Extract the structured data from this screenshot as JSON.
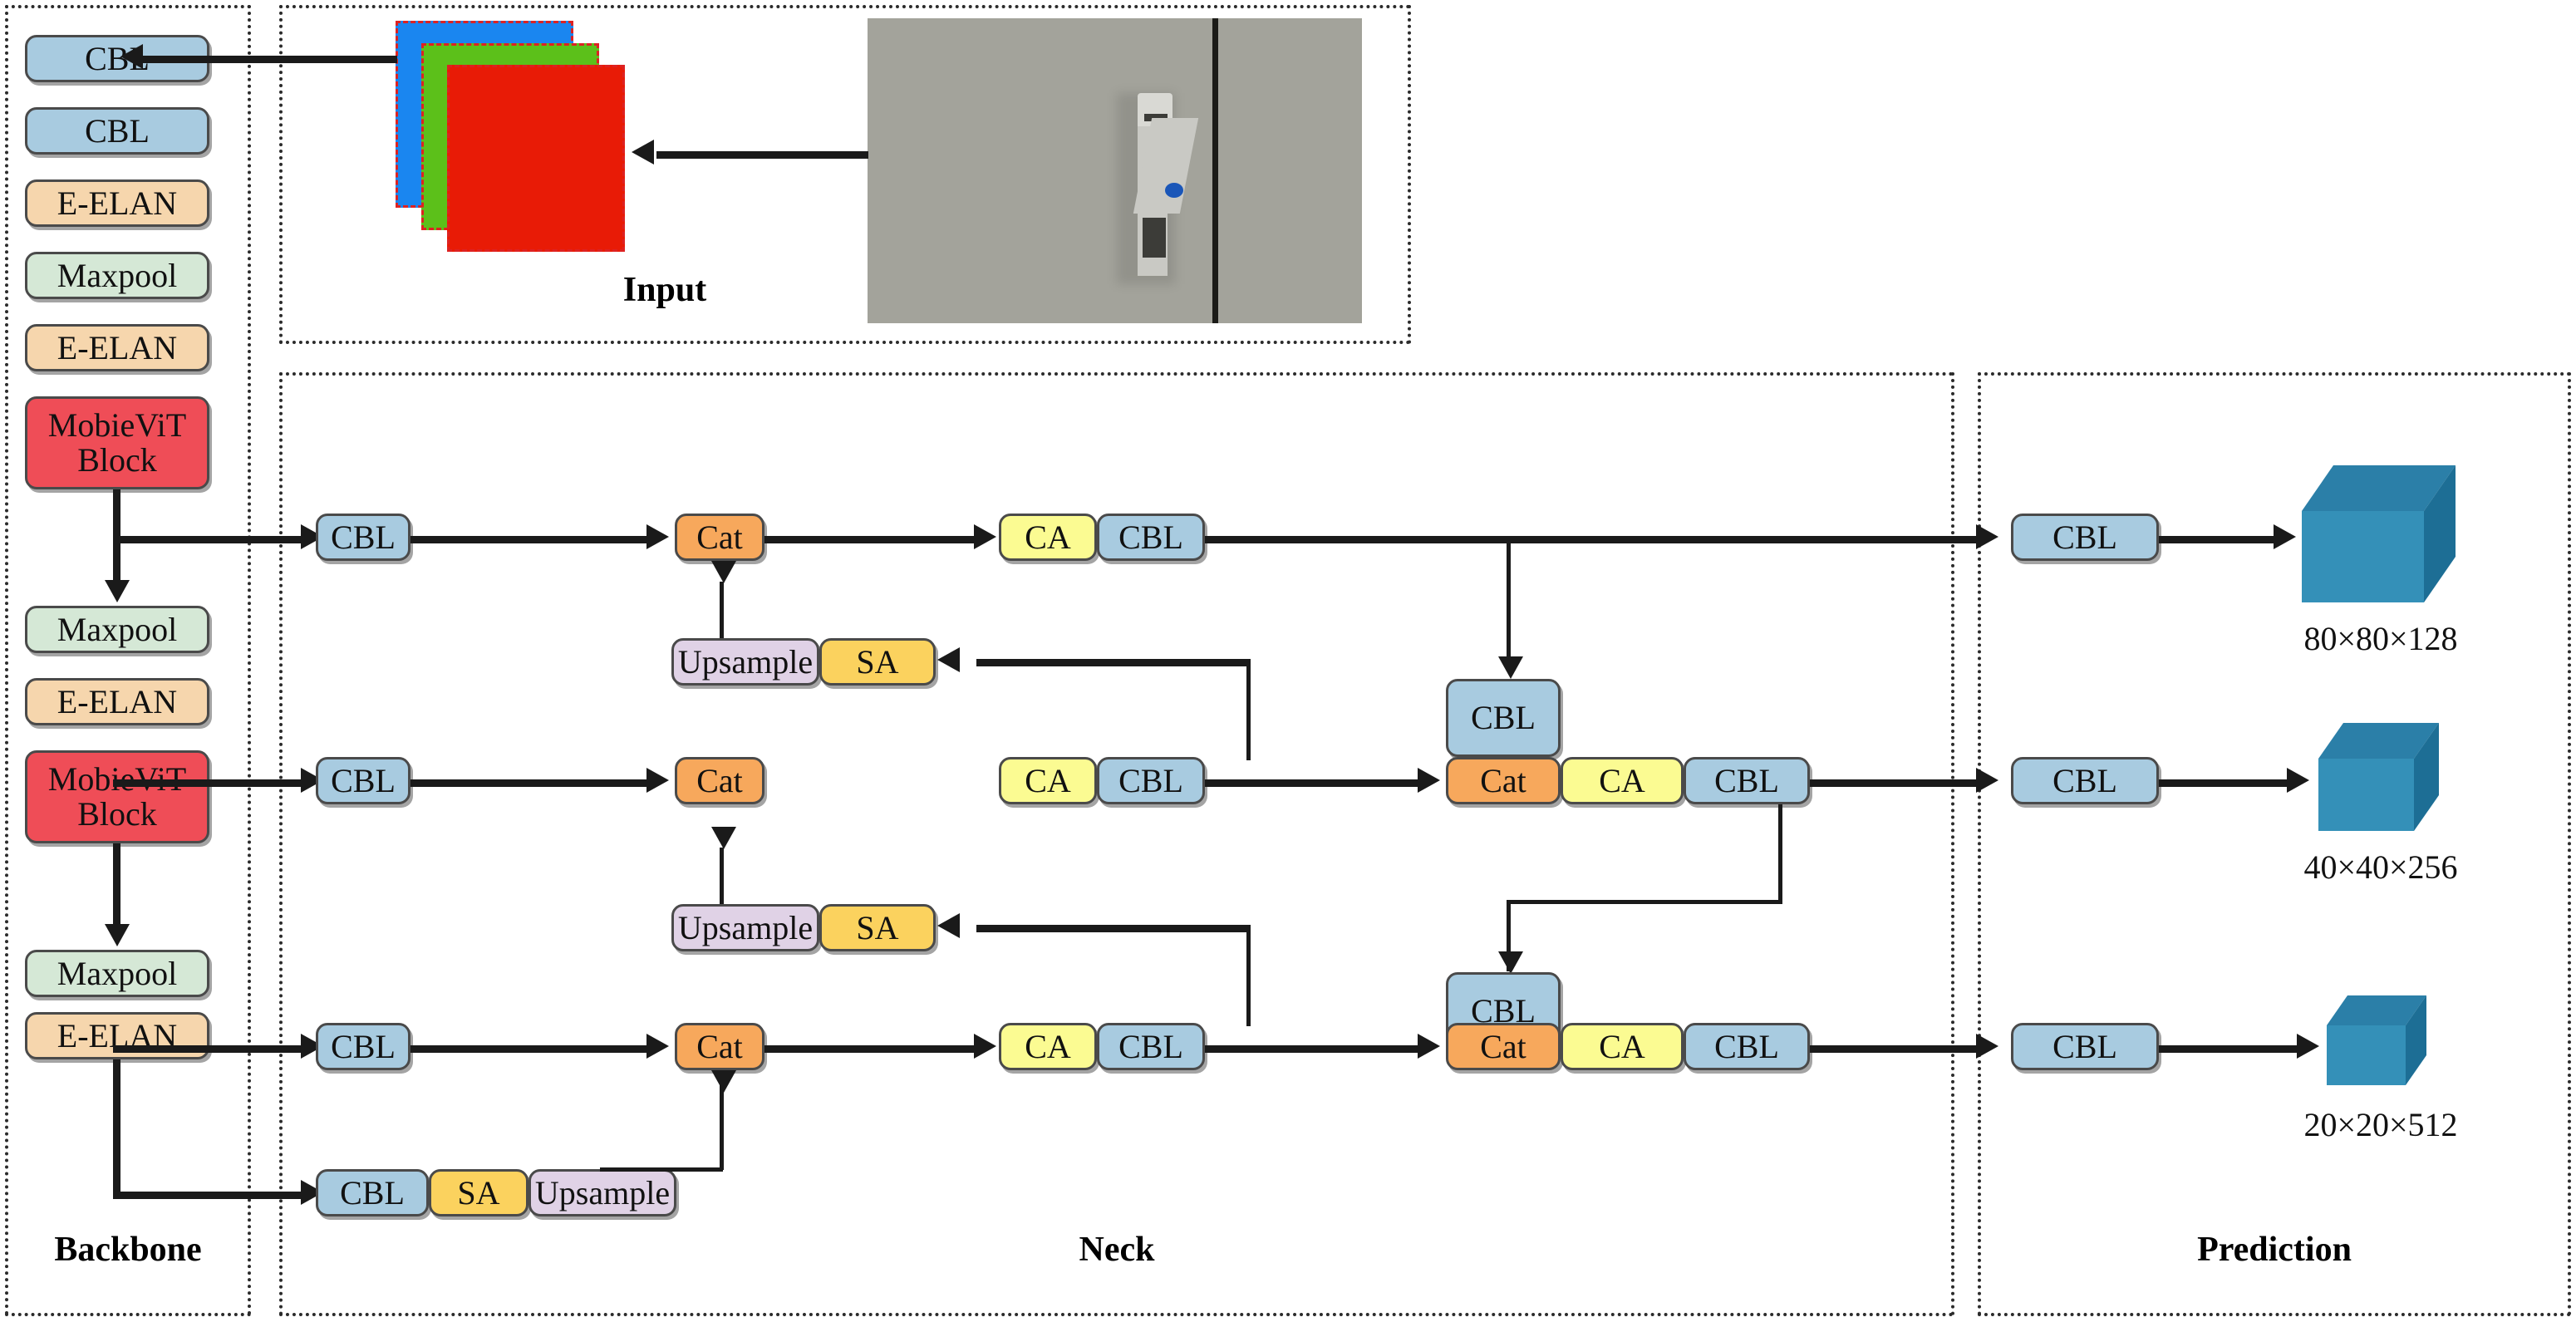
{
  "figure": {
    "type": "network-architecture-diagram",
    "sections": [
      {
        "id": "backbone",
        "label": "Backbone"
      },
      {
        "id": "input",
        "label": "Input"
      },
      {
        "id": "neck",
        "label": "Neck"
      },
      {
        "id": "prediction",
        "label": "Prediction"
      }
    ]
  },
  "colors": {
    "cbl": "#a8cbe0",
    "e_elan": "#f6d6ad",
    "maxpool": "#d5e8d6",
    "mobilevit": "#ef4d57",
    "cat": "#f7a85c",
    "ca": "#fbfb92",
    "sa": "#fbd25e",
    "upsample": "#e0d2e6",
    "cube": "#3490b8",
    "line": "#1a1a1a"
  },
  "backbone": {
    "label": "Backbone",
    "blocks": [
      {
        "id": "bb-cbl-1",
        "label": "CBL"
      },
      {
        "id": "bb-cbl-2",
        "label": "CBL"
      },
      {
        "id": "bb-elan-1",
        "label": "E-ELAN"
      },
      {
        "id": "bb-pool-1",
        "label": "Maxpool"
      },
      {
        "id": "bb-elan-2",
        "label": "E-ELAN"
      },
      {
        "id": "bb-vit-1",
        "label": "MobieViT Block",
        "line1": "MobieViT",
        "line2": "Block"
      },
      {
        "id": "bb-pool-2",
        "label": "Maxpool"
      },
      {
        "id": "bb-elan-3",
        "label": "E-ELAN"
      },
      {
        "id": "bb-vit-2",
        "label": "MobieViT Block",
        "line1": "MobieViT",
        "line2": "Block"
      },
      {
        "id": "bb-pool-3",
        "label": "Maxpool"
      },
      {
        "id": "bb-elan-4",
        "label": "E-ELAN"
      }
    ]
  },
  "input": {
    "label": "Input",
    "channels": [
      {
        "id": "chan-blue",
        "color": "#1a86f0"
      },
      {
        "id": "chan-green",
        "color": "#5cc01a"
      },
      {
        "id": "chan-red",
        "color": "#e81b06"
      }
    ],
    "photo_alt": "door with handle"
  },
  "neck": {
    "label": "Neck",
    "rows": {
      "top": [
        {
          "id": "nk-t-cbl",
          "label": "CBL"
        },
        {
          "id": "nk-t-cat",
          "label": "Cat"
        },
        {
          "id": "nk-t-ca",
          "label": "CA"
        },
        {
          "id": "nk-t-cbl2",
          "label": "CBL"
        }
      ],
      "up1": [
        {
          "id": "nk-u1-upsample",
          "label": "Upsample"
        },
        {
          "id": "nk-u1-sa",
          "label": "SA"
        }
      ],
      "mid": [
        {
          "id": "nk-m-cbl",
          "label": "CBL"
        },
        {
          "id": "nk-m-cat",
          "label": "Cat"
        },
        {
          "id": "nk-m-ca",
          "label": "CA"
        },
        {
          "id": "nk-m-cbl2",
          "label": "CBL"
        }
      ],
      "up2": [
        {
          "id": "nk-u2-upsample",
          "label": "Upsample"
        },
        {
          "id": "nk-u2-sa",
          "label": "SA"
        }
      ],
      "bot": [
        {
          "id": "nk-b-cbl",
          "label": "CBL"
        },
        {
          "id": "nk-b-cat",
          "label": "Cat"
        },
        {
          "id": "nk-b-ca",
          "label": "CA"
        },
        {
          "id": "nk-b-cbl2",
          "label": "CBL"
        }
      ],
      "down": [
        {
          "id": "nk-d-cbl",
          "label": "CBL"
        },
        {
          "id": "nk-d-sa",
          "label": "SA"
        },
        {
          "id": "nk-d-up",
          "label": "Upsample"
        }
      ],
      "merge1": [
        {
          "id": "nk-g1-cbl",
          "label": "CBL"
        },
        {
          "id": "nk-g1-cat",
          "label": "Cat"
        },
        {
          "id": "nk-g1-ca",
          "label": "CA"
        },
        {
          "id": "nk-g1-cbl2",
          "label": "CBL"
        }
      ],
      "merge2": [
        {
          "id": "nk-g2-cbl",
          "label": "CBL"
        },
        {
          "id": "nk-g2-cat",
          "label": "Cat"
        },
        {
          "id": "nk-g2-ca",
          "label": "CA"
        },
        {
          "id": "nk-g2-cbl2",
          "label": "CBL"
        }
      ]
    }
  },
  "prediction": {
    "label": "Prediction",
    "heads": [
      {
        "id": "pred-1",
        "block_label": "CBL",
        "output": "80×80×128",
        "cube_scale": 1.0
      },
      {
        "id": "pred-2",
        "block_label": "CBL",
        "output": "40×40×256",
        "cube_scale": 0.78
      },
      {
        "id": "pred-3",
        "block_label": "CBL",
        "output": "20×20×512",
        "cube_scale": 0.62
      }
    ]
  }
}
